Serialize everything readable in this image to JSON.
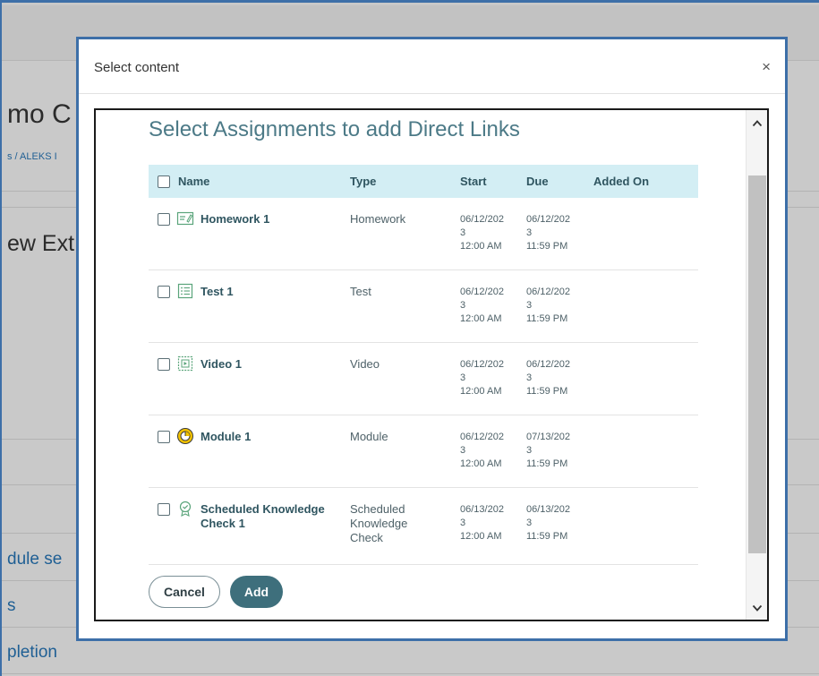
{
  "background": {
    "title_fragment": "mo C",
    "breadcrumb_fragment": "s / ALEKS I",
    "subtitle_fragment": "ew Ext",
    "links": [
      "dule se",
      "s",
      "pletion"
    ]
  },
  "modal": {
    "title": "Select content",
    "close_glyph": "×",
    "heading": "Select Assignments to add Direct Links",
    "columns": {
      "name": "Name",
      "type": "Type",
      "start": "Start",
      "due": "Due",
      "added_on": "Added On"
    },
    "rows": [
      {
        "name": "Homework 1",
        "type": "Homework",
        "icon": "homework-icon",
        "start": [
          "06/12/202",
          "3",
          "12:00 AM"
        ],
        "due": [
          "06/12/202",
          "3",
          "11:59 PM"
        ],
        "added_on": ""
      },
      {
        "name": "Test 1",
        "type": "Test",
        "icon": "test-icon",
        "start": [
          "06/12/202",
          "3",
          "12:00 AM"
        ],
        "due": [
          "06/12/202",
          "3",
          "11:59 PM"
        ],
        "added_on": ""
      },
      {
        "name": "Video 1",
        "type": "Video",
        "icon": "video-icon",
        "start": [
          "06/12/202",
          "3",
          "12:00 AM"
        ],
        "due": [
          "06/12/202",
          "3",
          "11:59 PM"
        ],
        "added_on": ""
      },
      {
        "name": "Module 1",
        "type": "Module",
        "icon": "module-icon",
        "start": [
          "06/12/202",
          "3",
          "12:00 AM"
        ],
        "due": [
          "07/13/202",
          "3",
          "11:59 PM"
        ],
        "added_on": ""
      },
      {
        "name_line1": "Scheduled Knowledge",
        "name_line2": "Check 1",
        "type_lines": [
          "Scheduled",
          "Knowledge",
          "Check"
        ],
        "icon": "knowledge-check-icon",
        "start": [
          "06/13/202",
          "3",
          "12:00 AM"
        ],
        "due": [
          "06/13/202",
          "3",
          "11:59 PM"
        ],
        "added_on": ""
      }
    ],
    "buttons": {
      "cancel": "Cancel",
      "add": "Add"
    }
  },
  "colors": {
    "modal_border": "#3d6fa8",
    "heading": "#4c7a87",
    "table_header_bg": "#d3eef4",
    "primary_button": "#3e6f7c",
    "icon_green": "#5aa47a",
    "module_icon_yellow": "#f2c200"
  }
}
